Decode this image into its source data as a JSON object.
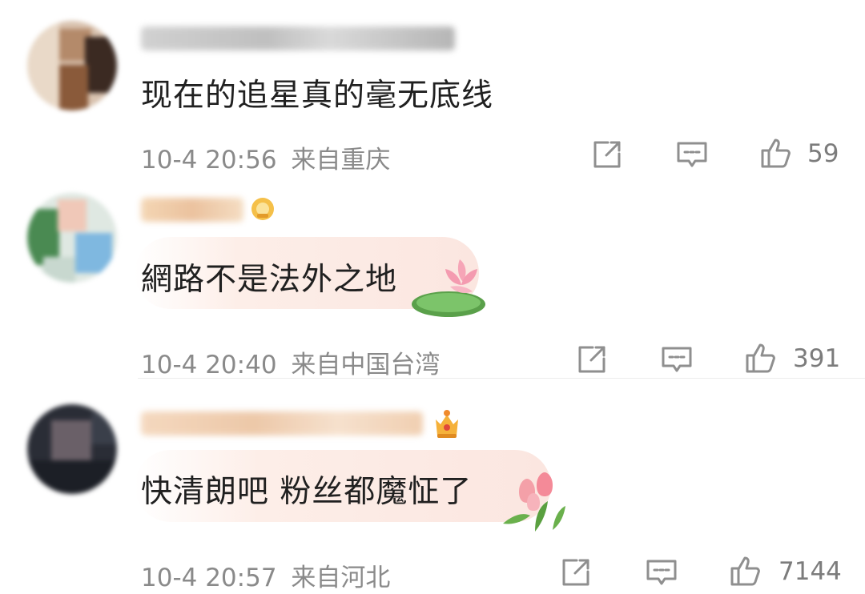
{
  "comments": [
    {
      "text": "现在的追星真的毫无底线",
      "time": "10-4 20:56",
      "location": "来自重庆",
      "likes": "59",
      "badge_icon": "",
      "sticker_icon": ""
    },
    {
      "text": "網路不是法外之地",
      "time": "10-4 20:40",
      "location": "来自中国台湾",
      "likes": "391",
      "badge_icon": "vip-badge-icon",
      "sticker_icon": "lotus-sticker-icon"
    },
    {
      "text": "快清朗吧 粉丝都魔怔了",
      "time": "10-4 20:57",
      "location": "来自河北",
      "likes": "7144",
      "badge_icon": "crown-badge-icon",
      "sticker_icon": "tulip-sticker-icon"
    }
  ],
  "colors": {
    "meta_text": "#8a8a8a",
    "content_text": "#202020",
    "bubble_tint": "#fdf0ea",
    "icon_stroke": "#8f8f8f"
  },
  "icons": [
    "repost-icon",
    "comment-icon",
    "like-icon"
  ]
}
